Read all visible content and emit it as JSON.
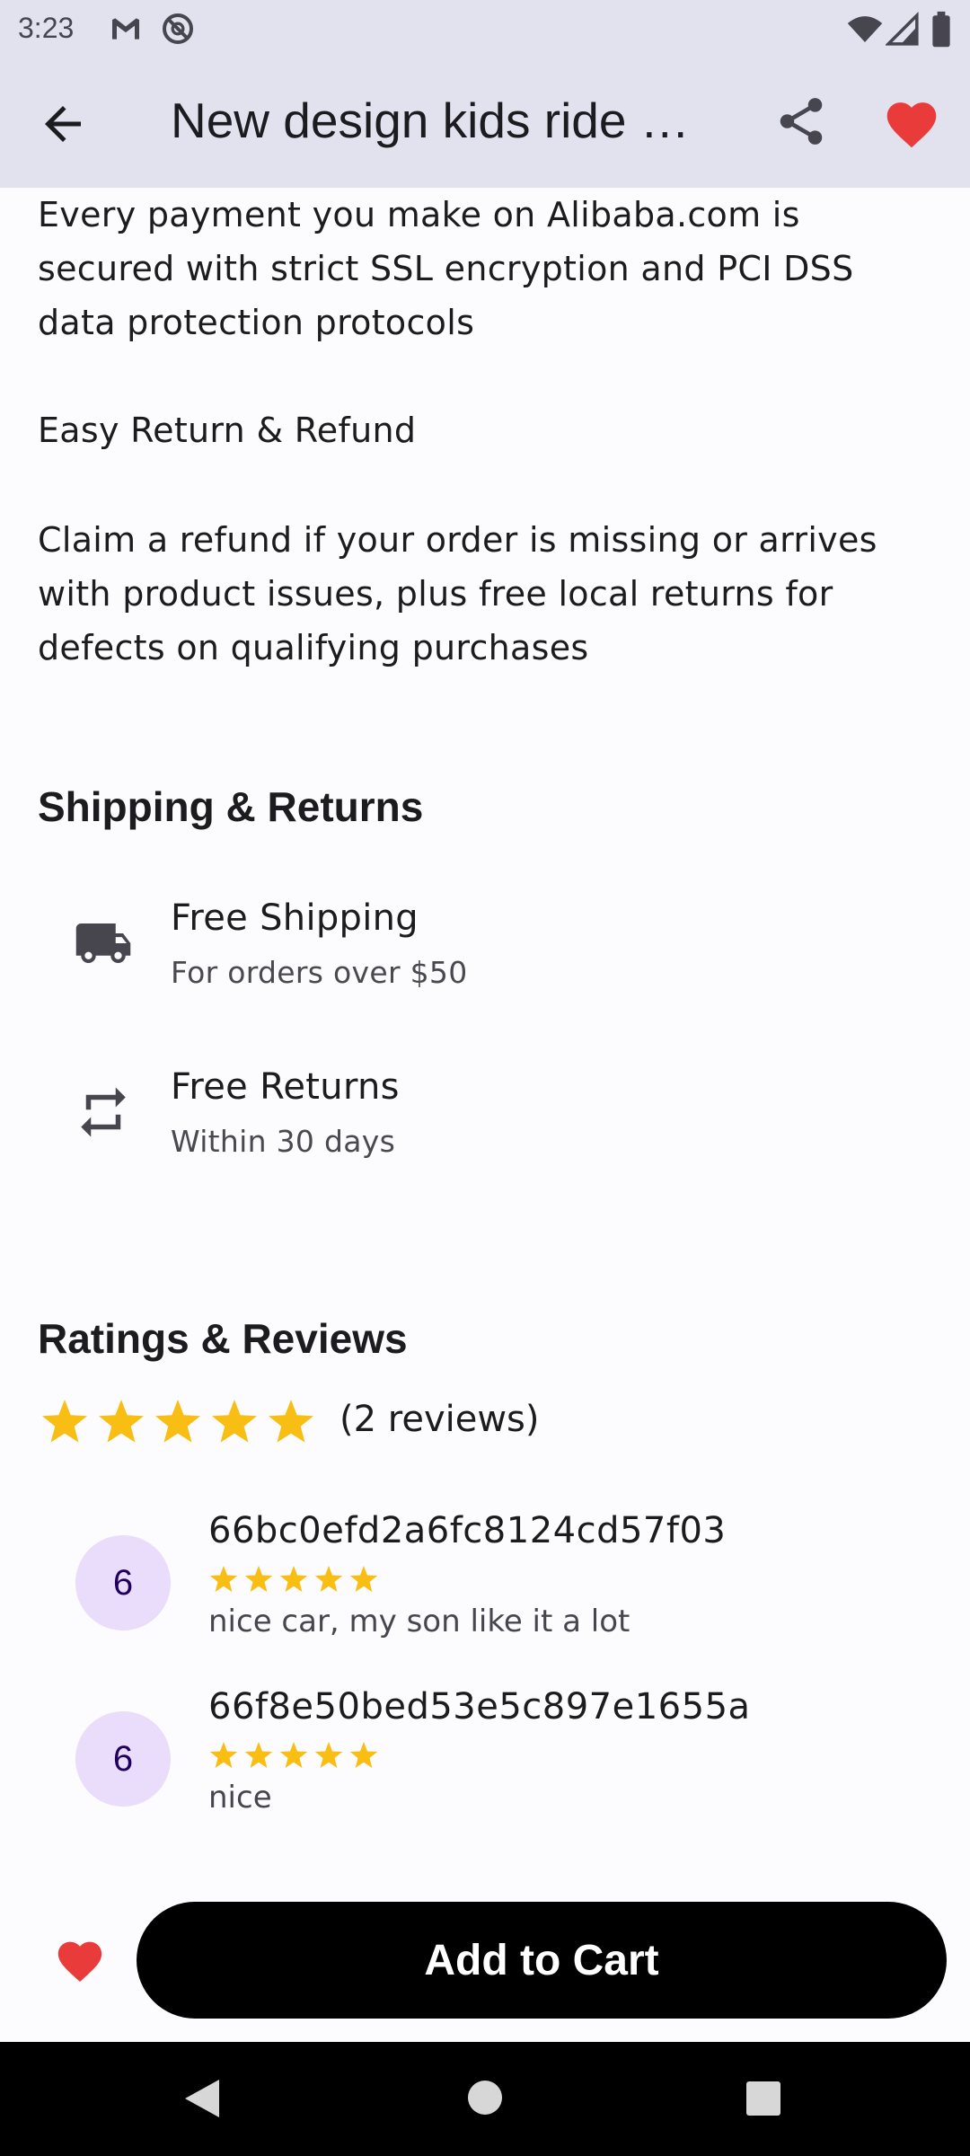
{
  "status_bar": {
    "time": "3:23",
    "icons": [
      "gmail-icon",
      "dnd-icon",
      "wifi-icon",
      "signal-icon",
      "battery-icon"
    ]
  },
  "app_bar": {
    "title": "New design kids ride …",
    "back_icon": "arrow-left-icon",
    "share_icon": "share-icon",
    "favorite_icon": "heart-icon",
    "favorite_color": "#ea3b3b"
  },
  "content": {
    "payment_text": "Every payment you make on Alibaba.com is secured with strict SSL encryption and PCI DSS data protection protocols",
    "return_heading": "Easy Return & Refund",
    "refund_text": "Claim a refund if your order is missing or arrives with product issues, plus free local returns for defects on qualifying purchases"
  },
  "shipping": {
    "title": "Shipping & Returns",
    "items": [
      {
        "icon": "truck-icon",
        "title": "Free Shipping",
        "subtitle": "For orders over $50"
      },
      {
        "icon": "repeat-icon",
        "title": "Free Returns",
        "subtitle": "Within 30 days"
      }
    ]
  },
  "ratings": {
    "title": "Ratings & Reviews",
    "stars": 5,
    "count_text": "(2 reviews)",
    "star_color": "#f9be14",
    "reviews": [
      {
        "avatar": "6",
        "user": "66bc0efd2a6fc8124cd57f03",
        "stars": 5,
        "text": "nice car, my son like it a lot"
      },
      {
        "avatar": "6",
        "user": "66f8e50bed53e5c897e1655a",
        "stars": 5,
        "text": "nice"
      }
    ]
  },
  "actions": {
    "favorite_icon": "heart-icon",
    "add_to_cart_label": "Add to Cart"
  },
  "nav_bar": {
    "icons": [
      "back-triangle-icon",
      "home-circle-icon",
      "recents-square-icon"
    ]
  }
}
